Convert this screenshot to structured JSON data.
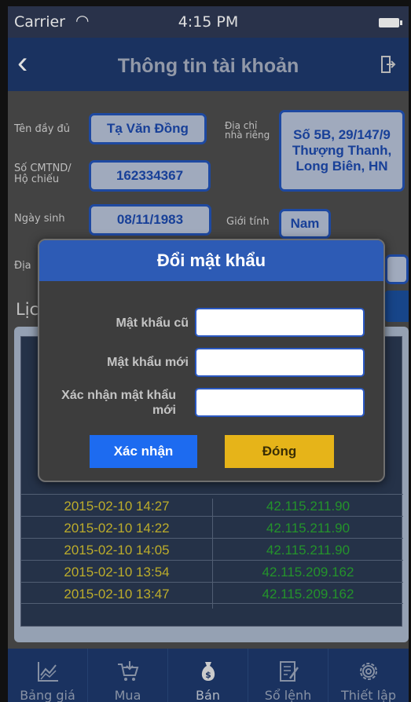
{
  "status_bar": {
    "carrier": "Carrier",
    "time": "4:15 PM"
  },
  "nav": {
    "title": "Thông tin tài khoản"
  },
  "profile": {
    "fullname_label": "Tên đầy đủ",
    "fullname_value": "Tạ Văn Đồng",
    "address_label": "Địa chỉ nhà riêng",
    "address_value": "Số 5B, 29/147/9 Thượng Thanh, Long Biên, HN",
    "id_label": "Số CMTND/ Hộ chiếu",
    "id_value": "162334367",
    "birth_label": "Ngày sinh",
    "birth_value": "08/11/1983",
    "gender_label": "Giới tính",
    "gender_value": "Nam",
    "partial_label": "Địa",
    "section_partial": "Lịc"
  },
  "history": {
    "rows": [
      {
        "time": "2015-02-10 14:27",
        "ip": "42.115.211.90"
      },
      {
        "time": "2015-02-10 14:22",
        "ip": "42.115.211.90"
      },
      {
        "time": "2015-02-10 14:05",
        "ip": "42.115.211.90"
      },
      {
        "time": "2015-02-10 13:54",
        "ip": "42.115.209.162"
      },
      {
        "time": "2015-02-10 13:47",
        "ip": "42.115.209.162"
      }
    ]
  },
  "dialog": {
    "title": "Đổi mật khẩu",
    "old_label": "Mật khẩu cũ",
    "new_label": "Mật khẩu mới",
    "confirm_label": "Xác nhận mật khẩu mới",
    "confirm_button": "Xác nhận",
    "close_button": "Đóng"
  },
  "tabs": [
    {
      "label": "Bảng giá",
      "icon": "chart-icon"
    },
    {
      "label": "Mua",
      "icon": "cart-icon"
    },
    {
      "label": "Bán",
      "icon": "money-bag-icon"
    },
    {
      "label": "Sổ lệnh",
      "icon": "order-book-icon"
    },
    {
      "label": "Thiết lập",
      "icon": "gear-icon"
    }
  ],
  "colors": {
    "nav": "#1e3a6e",
    "field_border": "#2354b8",
    "confirm": "#1d6bf0",
    "close": "#e6b419",
    "time_text": "#d6c431",
    "ip_text": "#2aa831"
  }
}
